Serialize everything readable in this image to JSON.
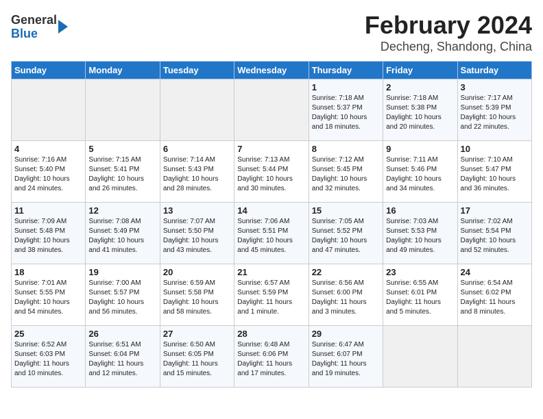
{
  "logo": {
    "general": "General",
    "blue": "Blue"
  },
  "title": "February 2024",
  "subtitle": "Decheng, Shandong, China",
  "days_of_week": [
    "Sunday",
    "Monday",
    "Tuesday",
    "Wednesday",
    "Thursday",
    "Friday",
    "Saturday"
  ],
  "weeks": [
    [
      {
        "day": "",
        "info": ""
      },
      {
        "day": "",
        "info": ""
      },
      {
        "day": "",
        "info": ""
      },
      {
        "day": "",
        "info": ""
      },
      {
        "day": "1",
        "info": "Sunrise: 7:18 AM\nSunset: 5:37 PM\nDaylight: 10 hours\nand 18 minutes."
      },
      {
        "day": "2",
        "info": "Sunrise: 7:18 AM\nSunset: 5:38 PM\nDaylight: 10 hours\nand 20 minutes."
      },
      {
        "day": "3",
        "info": "Sunrise: 7:17 AM\nSunset: 5:39 PM\nDaylight: 10 hours\nand 22 minutes."
      }
    ],
    [
      {
        "day": "4",
        "info": "Sunrise: 7:16 AM\nSunset: 5:40 PM\nDaylight: 10 hours\nand 24 minutes."
      },
      {
        "day": "5",
        "info": "Sunrise: 7:15 AM\nSunset: 5:41 PM\nDaylight: 10 hours\nand 26 minutes."
      },
      {
        "day": "6",
        "info": "Sunrise: 7:14 AM\nSunset: 5:43 PM\nDaylight: 10 hours\nand 28 minutes."
      },
      {
        "day": "7",
        "info": "Sunrise: 7:13 AM\nSunset: 5:44 PM\nDaylight: 10 hours\nand 30 minutes."
      },
      {
        "day": "8",
        "info": "Sunrise: 7:12 AM\nSunset: 5:45 PM\nDaylight: 10 hours\nand 32 minutes."
      },
      {
        "day": "9",
        "info": "Sunrise: 7:11 AM\nSunset: 5:46 PM\nDaylight: 10 hours\nand 34 minutes."
      },
      {
        "day": "10",
        "info": "Sunrise: 7:10 AM\nSunset: 5:47 PM\nDaylight: 10 hours\nand 36 minutes."
      }
    ],
    [
      {
        "day": "11",
        "info": "Sunrise: 7:09 AM\nSunset: 5:48 PM\nDaylight: 10 hours\nand 38 minutes."
      },
      {
        "day": "12",
        "info": "Sunrise: 7:08 AM\nSunset: 5:49 PM\nDaylight: 10 hours\nand 41 minutes."
      },
      {
        "day": "13",
        "info": "Sunrise: 7:07 AM\nSunset: 5:50 PM\nDaylight: 10 hours\nand 43 minutes."
      },
      {
        "day": "14",
        "info": "Sunrise: 7:06 AM\nSunset: 5:51 PM\nDaylight: 10 hours\nand 45 minutes."
      },
      {
        "day": "15",
        "info": "Sunrise: 7:05 AM\nSunset: 5:52 PM\nDaylight: 10 hours\nand 47 minutes."
      },
      {
        "day": "16",
        "info": "Sunrise: 7:03 AM\nSunset: 5:53 PM\nDaylight: 10 hours\nand 49 minutes."
      },
      {
        "day": "17",
        "info": "Sunrise: 7:02 AM\nSunset: 5:54 PM\nDaylight: 10 hours\nand 52 minutes."
      }
    ],
    [
      {
        "day": "18",
        "info": "Sunrise: 7:01 AM\nSunset: 5:55 PM\nDaylight: 10 hours\nand 54 minutes."
      },
      {
        "day": "19",
        "info": "Sunrise: 7:00 AM\nSunset: 5:57 PM\nDaylight: 10 hours\nand 56 minutes."
      },
      {
        "day": "20",
        "info": "Sunrise: 6:59 AM\nSunset: 5:58 PM\nDaylight: 10 hours\nand 58 minutes."
      },
      {
        "day": "21",
        "info": "Sunrise: 6:57 AM\nSunset: 5:59 PM\nDaylight: 11 hours\nand 1 minute."
      },
      {
        "day": "22",
        "info": "Sunrise: 6:56 AM\nSunset: 6:00 PM\nDaylight: 11 hours\nand 3 minutes."
      },
      {
        "day": "23",
        "info": "Sunrise: 6:55 AM\nSunset: 6:01 PM\nDaylight: 11 hours\nand 5 minutes."
      },
      {
        "day": "24",
        "info": "Sunrise: 6:54 AM\nSunset: 6:02 PM\nDaylight: 11 hours\nand 8 minutes."
      }
    ],
    [
      {
        "day": "25",
        "info": "Sunrise: 6:52 AM\nSunset: 6:03 PM\nDaylight: 11 hours\nand 10 minutes."
      },
      {
        "day": "26",
        "info": "Sunrise: 6:51 AM\nSunset: 6:04 PM\nDaylight: 11 hours\nand 12 minutes."
      },
      {
        "day": "27",
        "info": "Sunrise: 6:50 AM\nSunset: 6:05 PM\nDaylight: 11 hours\nand 15 minutes."
      },
      {
        "day": "28",
        "info": "Sunrise: 6:48 AM\nSunset: 6:06 PM\nDaylight: 11 hours\nand 17 minutes."
      },
      {
        "day": "29",
        "info": "Sunrise: 6:47 AM\nSunset: 6:07 PM\nDaylight: 11 hours\nand 19 minutes."
      },
      {
        "day": "",
        "info": ""
      },
      {
        "day": "",
        "info": ""
      }
    ]
  ]
}
